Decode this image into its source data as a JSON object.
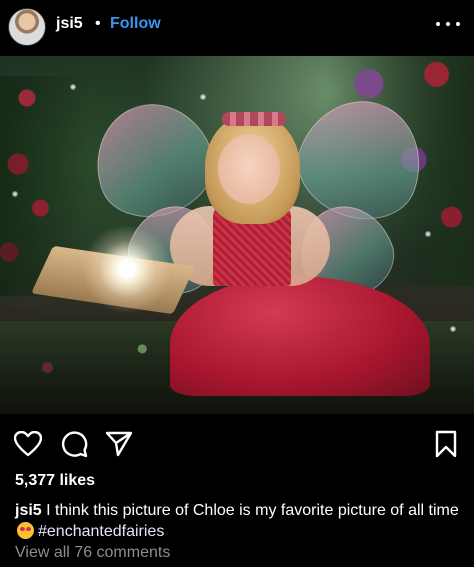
{
  "header": {
    "username": "jsi5",
    "separator": "•",
    "follow_label": "Follow",
    "more_icon": "more-horizontal-icon"
  },
  "post": {
    "image_subject": "enchanted fairy portrait"
  },
  "actions": {
    "like_icon": "heart-icon",
    "comment_icon": "comment-icon",
    "share_icon": "send-icon",
    "save_icon": "bookmark-icon"
  },
  "likes": "5,377 likes",
  "caption": {
    "username": "jsi5",
    "text": "I think this picture of Chloe is my favorite picture of all time",
    "emoji": "heart-eyes-emoji",
    "hashtag": "#enchantedfairies"
  },
  "comments": {
    "view_all_label": "View all 76 comments"
  },
  "colors": {
    "background": "#000000",
    "follow_blue": "#3897f0",
    "muted_text": "#8e8e8e"
  }
}
